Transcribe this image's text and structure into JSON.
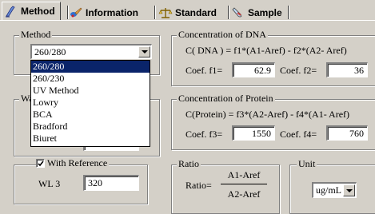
{
  "tabs": [
    {
      "label": "Method",
      "icon": "flask-icon",
      "active": true
    },
    {
      "label": "Information",
      "icon": "paint-icon",
      "active": false
    },
    {
      "label": "Standard",
      "icon": "balance-icon",
      "active": false
    },
    {
      "label": "Sample",
      "icon": "tube-icon",
      "active": false
    }
  ],
  "method": {
    "legend": "Method",
    "selected": "260/280",
    "options": [
      "260/280",
      "260/230",
      "UV Method",
      "Lowry",
      "BCA",
      "Bradford",
      "Biuret"
    ]
  },
  "wavelength": {
    "legend_partial": "Wa",
    "with_reference_label": "With Reference",
    "with_reference_checked": true,
    "wl3_label": "WL 3",
    "wl3_value": "320"
  },
  "dna": {
    "legend": "Concentration of DNA",
    "formula": "C( DNA ) = f1*(A1-Aref) - f2*(A2- Aref)",
    "f1_label": "Coef. f1=",
    "f1_value": "62.9",
    "f2_label": "Coef. f2=",
    "f2_value": "36"
  },
  "protein": {
    "legend": "Concentration of Protein",
    "formula": "C(Protein) = f3*(A2-Aref) - f4*(A1- Aref)",
    "f3_label": "Coef. f3=",
    "f3_value": "1550",
    "f4_label": "Coef. f4=",
    "f4_value": "760"
  },
  "ratio": {
    "legend": "Ratio",
    "label": "Ratio=",
    "numerator": "A1-Aref",
    "denominator": "A2-Aref"
  },
  "unit": {
    "legend": "Unit",
    "selected": "ug/mL"
  },
  "colors": {
    "face": "#d4d0c8",
    "highlight": "#0a246a"
  }
}
